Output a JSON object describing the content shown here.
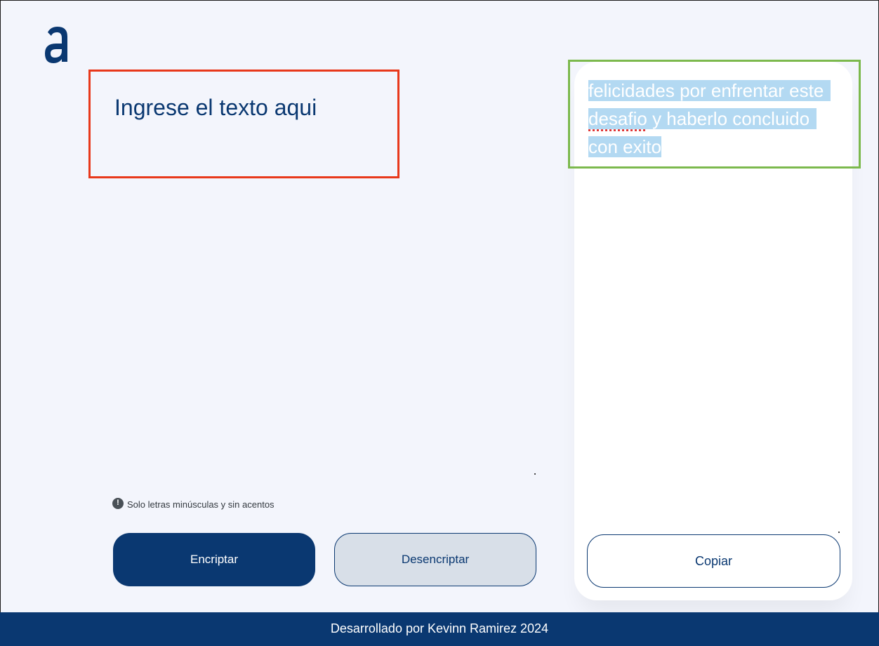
{
  "logo": {
    "icon": "alura-a-logo",
    "color": "#0a3871"
  },
  "input": {
    "placeholder": "Ingrese el texto aqui"
  },
  "hint": {
    "icon": "exclamation-circle-icon",
    "text": "Solo letras minúsculas y sin acentos"
  },
  "buttons": {
    "encrypt_label": "Encriptar",
    "decrypt_label": "Desencriptar",
    "copy_label": "Copiar"
  },
  "output": {
    "line1": "felicidades por enfrentar este",
    "line2_word": "desafio",
    "line2_rest": " y haberlo concluido",
    "line3": "con exito"
  },
  "footer": {
    "text": "Desarrollado por Kevinn Ramirez 2024"
  },
  "colors": {
    "primary": "#0a3871",
    "background": "#f3f5fc",
    "highlight_red": "#e8381b",
    "highlight_green": "#7cb94d",
    "selection": "#b3d9f2"
  }
}
